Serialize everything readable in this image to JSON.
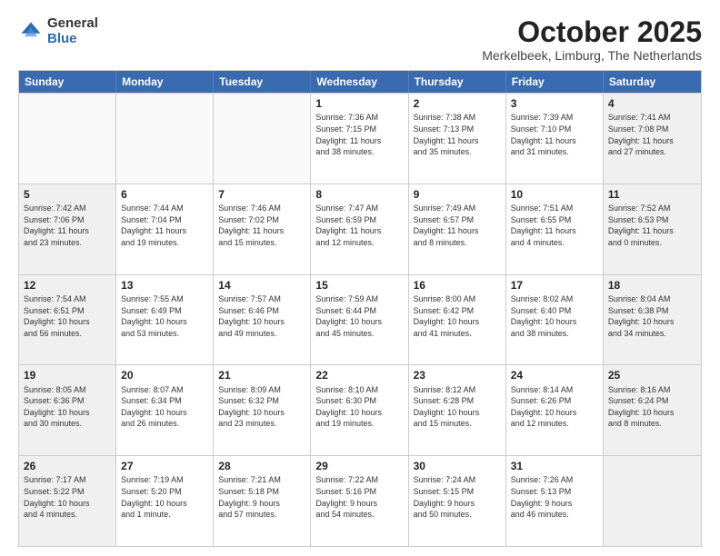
{
  "logo": {
    "general": "General",
    "blue": "Blue"
  },
  "title": "October 2025",
  "location": "Merkelbeek, Limburg, The Netherlands",
  "weekdays": [
    "Sunday",
    "Monday",
    "Tuesday",
    "Wednesday",
    "Thursday",
    "Friday",
    "Saturday"
  ],
  "rows": [
    [
      {
        "day": "",
        "info": "",
        "empty": true
      },
      {
        "day": "",
        "info": "",
        "empty": true
      },
      {
        "day": "",
        "info": "",
        "empty": true
      },
      {
        "day": "1",
        "info": "Sunrise: 7:36 AM\nSunset: 7:15 PM\nDaylight: 11 hours\nand 38 minutes.",
        "empty": false
      },
      {
        "day": "2",
        "info": "Sunrise: 7:38 AM\nSunset: 7:13 PM\nDaylight: 11 hours\nand 35 minutes.",
        "empty": false
      },
      {
        "day": "3",
        "info": "Sunrise: 7:39 AM\nSunset: 7:10 PM\nDaylight: 11 hours\nand 31 minutes.",
        "empty": false
      },
      {
        "day": "4",
        "info": "Sunrise: 7:41 AM\nSunset: 7:08 PM\nDaylight: 11 hours\nand 27 minutes.",
        "empty": false,
        "shaded": true
      }
    ],
    [
      {
        "day": "5",
        "info": "Sunrise: 7:42 AM\nSunset: 7:06 PM\nDaylight: 11 hours\nand 23 minutes.",
        "empty": false,
        "shaded": true
      },
      {
        "day": "6",
        "info": "Sunrise: 7:44 AM\nSunset: 7:04 PM\nDaylight: 11 hours\nand 19 minutes.",
        "empty": false
      },
      {
        "day": "7",
        "info": "Sunrise: 7:46 AM\nSunset: 7:02 PM\nDaylight: 11 hours\nand 15 minutes.",
        "empty": false
      },
      {
        "day": "8",
        "info": "Sunrise: 7:47 AM\nSunset: 6:59 PM\nDaylight: 11 hours\nand 12 minutes.",
        "empty": false
      },
      {
        "day": "9",
        "info": "Sunrise: 7:49 AM\nSunset: 6:57 PM\nDaylight: 11 hours\nand 8 minutes.",
        "empty": false
      },
      {
        "day": "10",
        "info": "Sunrise: 7:51 AM\nSunset: 6:55 PM\nDaylight: 11 hours\nand 4 minutes.",
        "empty": false
      },
      {
        "day": "11",
        "info": "Sunrise: 7:52 AM\nSunset: 6:53 PM\nDaylight: 11 hours\nand 0 minutes.",
        "empty": false,
        "shaded": true
      }
    ],
    [
      {
        "day": "12",
        "info": "Sunrise: 7:54 AM\nSunset: 6:51 PM\nDaylight: 10 hours\nand 56 minutes.",
        "empty": false,
        "shaded": true
      },
      {
        "day": "13",
        "info": "Sunrise: 7:55 AM\nSunset: 6:49 PM\nDaylight: 10 hours\nand 53 minutes.",
        "empty": false
      },
      {
        "day": "14",
        "info": "Sunrise: 7:57 AM\nSunset: 6:46 PM\nDaylight: 10 hours\nand 49 minutes.",
        "empty": false
      },
      {
        "day": "15",
        "info": "Sunrise: 7:59 AM\nSunset: 6:44 PM\nDaylight: 10 hours\nand 45 minutes.",
        "empty": false
      },
      {
        "day": "16",
        "info": "Sunrise: 8:00 AM\nSunset: 6:42 PM\nDaylight: 10 hours\nand 41 minutes.",
        "empty": false
      },
      {
        "day": "17",
        "info": "Sunrise: 8:02 AM\nSunset: 6:40 PM\nDaylight: 10 hours\nand 38 minutes.",
        "empty": false
      },
      {
        "day": "18",
        "info": "Sunrise: 8:04 AM\nSunset: 6:38 PM\nDaylight: 10 hours\nand 34 minutes.",
        "empty": false,
        "shaded": true
      }
    ],
    [
      {
        "day": "19",
        "info": "Sunrise: 8:05 AM\nSunset: 6:36 PM\nDaylight: 10 hours\nand 30 minutes.",
        "empty": false,
        "shaded": true
      },
      {
        "day": "20",
        "info": "Sunrise: 8:07 AM\nSunset: 6:34 PM\nDaylight: 10 hours\nand 26 minutes.",
        "empty": false
      },
      {
        "day": "21",
        "info": "Sunrise: 8:09 AM\nSunset: 6:32 PM\nDaylight: 10 hours\nand 23 minutes.",
        "empty": false
      },
      {
        "day": "22",
        "info": "Sunrise: 8:10 AM\nSunset: 6:30 PM\nDaylight: 10 hours\nand 19 minutes.",
        "empty": false
      },
      {
        "day": "23",
        "info": "Sunrise: 8:12 AM\nSunset: 6:28 PM\nDaylight: 10 hours\nand 15 minutes.",
        "empty": false
      },
      {
        "day": "24",
        "info": "Sunrise: 8:14 AM\nSunset: 6:26 PM\nDaylight: 10 hours\nand 12 minutes.",
        "empty": false
      },
      {
        "day": "25",
        "info": "Sunrise: 8:16 AM\nSunset: 6:24 PM\nDaylight: 10 hours\nand 8 minutes.",
        "empty": false,
        "shaded": true
      }
    ],
    [
      {
        "day": "26",
        "info": "Sunrise: 7:17 AM\nSunset: 5:22 PM\nDaylight: 10 hours\nand 4 minutes.",
        "empty": false,
        "shaded": true
      },
      {
        "day": "27",
        "info": "Sunrise: 7:19 AM\nSunset: 5:20 PM\nDaylight: 10 hours\nand 1 minute.",
        "empty": false
      },
      {
        "day": "28",
        "info": "Sunrise: 7:21 AM\nSunset: 5:18 PM\nDaylight: 9 hours\nand 57 minutes.",
        "empty": false
      },
      {
        "day": "29",
        "info": "Sunrise: 7:22 AM\nSunset: 5:16 PM\nDaylight: 9 hours\nand 54 minutes.",
        "empty": false
      },
      {
        "day": "30",
        "info": "Sunrise: 7:24 AM\nSunset: 5:15 PM\nDaylight: 9 hours\nand 50 minutes.",
        "empty": false
      },
      {
        "day": "31",
        "info": "Sunrise: 7:26 AM\nSunset: 5:13 PM\nDaylight: 9 hours\nand 46 minutes.",
        "empty": false
      },
      {
        "day": "",
        "info": "",
        "empty": true,
        "shaded": true
      }
    ]
  ]
}
